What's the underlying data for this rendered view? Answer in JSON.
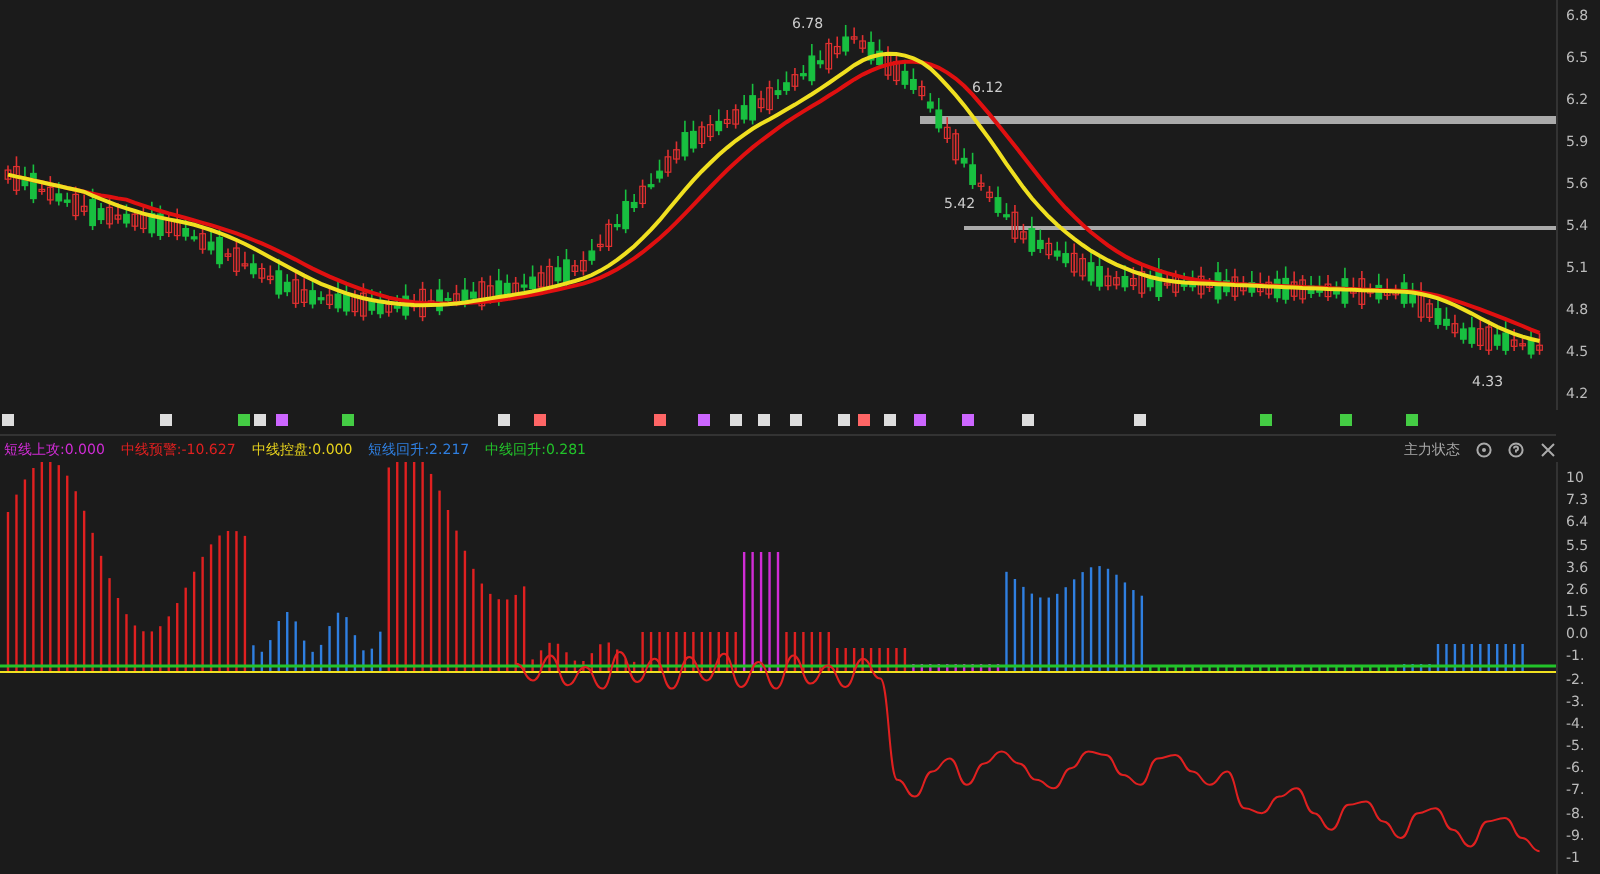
{
  "price_panel": {
    "annotations": [
      {
        "kind": "high",
        "text": "6.78"
      },
      {
        "kind": "mark",
        "text": "6.12"
      },
      {
        "kind": "mark",
        "text": "5.42"
      },
      {
        "kind": "low",
        "text": "4.33"
      }
    ],
    "axis": [
      "6.8",
      "6.5",
      "6.2",
      "5.9",
      "5.6",
      "5.4",
      "5.1",
      "4.8",
      "4.5",
      "4.2"
    ]
  },
  "indicator_panel": {
    "title": "主力状态",
    "legend": [
      {
        "text": "短线上攻:0.000",
        "color": "#d12cd6"
      },
      {
        "text": "中线预警:-10.627",
        "color": "#e02020"
      },
      {
        "text": "中线控盘:0.000",
        "color": "#e6d21c"
      },
      {
        "text": "短线回升:2.217",
        "color": "#2f7fe0"
      },
      {
        "text": "中线回升:0.281",
        "color": "#22c32a"
      }
    ],
    "axis": [
      "10",
      "7.3",
      "6.4",
      "5.5",
      "3.6",
      "2.6",
      "1.5",
      "0.0",
      "-1.",
      "-2.",
      "-3.",
      "-4.",
      "-5.",
      "-6.",
      "-7.",
      "-8.",
      "-9.",
      "-1"
    ]
  }
}
